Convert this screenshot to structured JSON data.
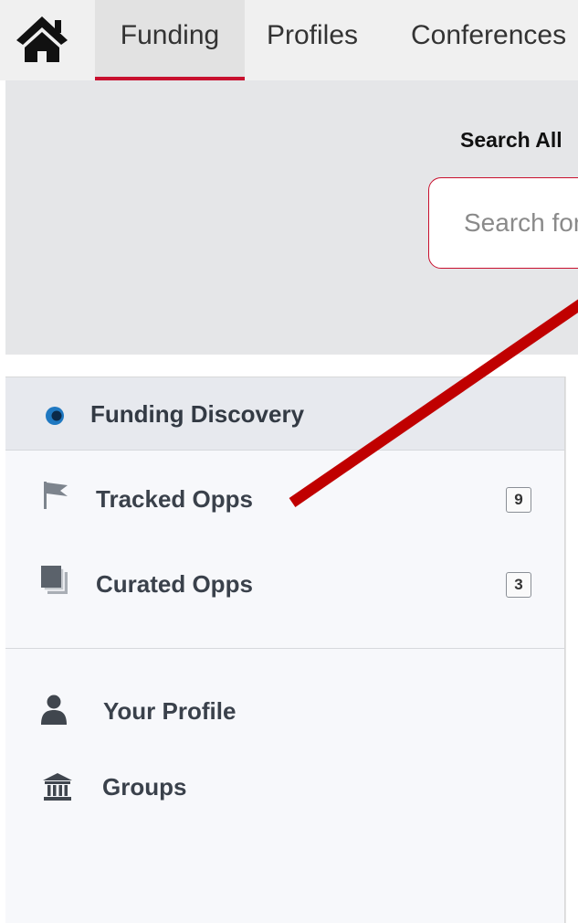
{
  "topnav": {
    "tabs": [
      {
        "label": "Funding",
        "active": true
      },
      {
        "label": "Profiles",
        "active": false
      },
      {
        "label": "Conferences",
        "active": false
      }
    ],
    "home_icon": "home-icon"
  },
  "search": {
    "title": "Search All",
    "placeholder": "Search for funding"
  },
  "sidebar": {
    "header": {
      "label": "Funding Discovery",
      "icon": "funding-discovery-icon"
    },
    "items": [
      {
        "label": "Tracked Opps",
        "icon": "flag-icon",
        "count": "9"
      },
      {
        "label": "Curated Opps",
        "icon": "stacked-pages-icon",
        "count": "3"
      },
      {
        "label": "Your Profile",
        "icon": "user-icon"
      },
      {
        "label": "Groups",
        "icon": "institution-icon"
      }
    ]
  },
  "colors": {
    "accent": "#c8102e",
    "annotation_arrow": "#c00000",
    "icon_gray": "#4a5058",
    "discovery_icon": "#1f78c1"
  }
}
